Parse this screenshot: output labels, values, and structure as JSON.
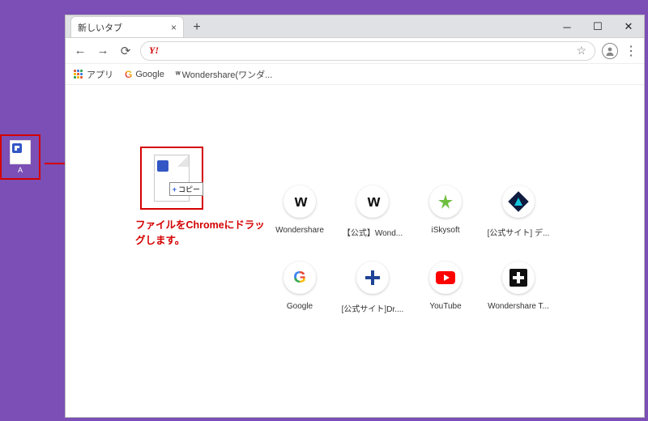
{
  "desktop_shortcut": {
    "label": "A"
  },
  "browser": {
    "tab": {
      "title": "新しいタブ"
    },
    "toolbar": {
      "url_display": "",
      "site_indicator": "Y!"
    },
    "bookmarks": {
      "apps": "アプリ",
      "google": "Google",
      "wondershare": "Wondershare(ワンダ..."
    }
  },
  "drag": {
    "copy_chip": "コピー",
    "caption": "ファイルをChromeにドラッグします。"
  },
  "shortcuts": [
    {
      "id": "wondershare",
      "label": "Wondershare"
    },
    {
      "id": "official-wond",
      "label": "【公式】Wond..."
    },
    {
      "id": "iskysoft",
      "label": "iSkysoft"
    },
    {
      "id": "official-site-de",
      "label": "[公式サイト] デ..."
    },
    {
      "id": "google",
      "label": "Google"
    },
    {
      "id": "official-site-dr",
      "label": "[公式サイト]Dr...."
    },
    {
      "id": "youtube",
      "label": "YouTube"
    },
    {
      "id": "wondershare-t",
      "label": "Wondershare T..."
    }
  ]
}
